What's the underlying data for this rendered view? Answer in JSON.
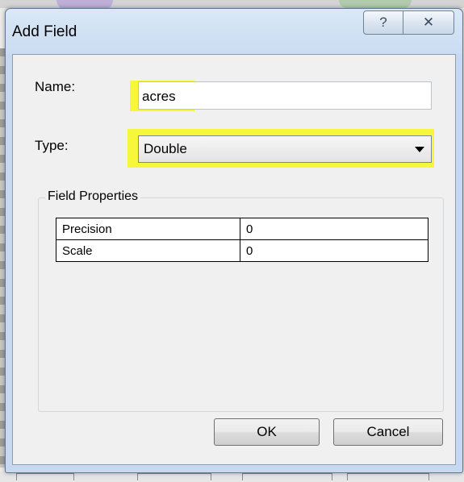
{
  "dialog": {
    "title": "Add Field",
    "help_button": "?",
    "close_button": "✕"
  },
  "name": {
    "label": "Name:",
    "value": "acres"
  },
  "type": {
    "label": "Type:",
    "selected": "Double"
  },
  "field_properties": {
    "title": "Field Properties",
    "rows": [
      {
        "property": "Precision",
        "value": "0"
      },
      {
        "property": "Scale",
        "value": "0"
      }
    ]
  },
  "buttons": {
    "ok": "OK",
    "cancel": "Cancel"
  },
  "colors": {
    "highlight": "#f7f71a",
    "title_bar": "#c9dcf1"
  }
}
